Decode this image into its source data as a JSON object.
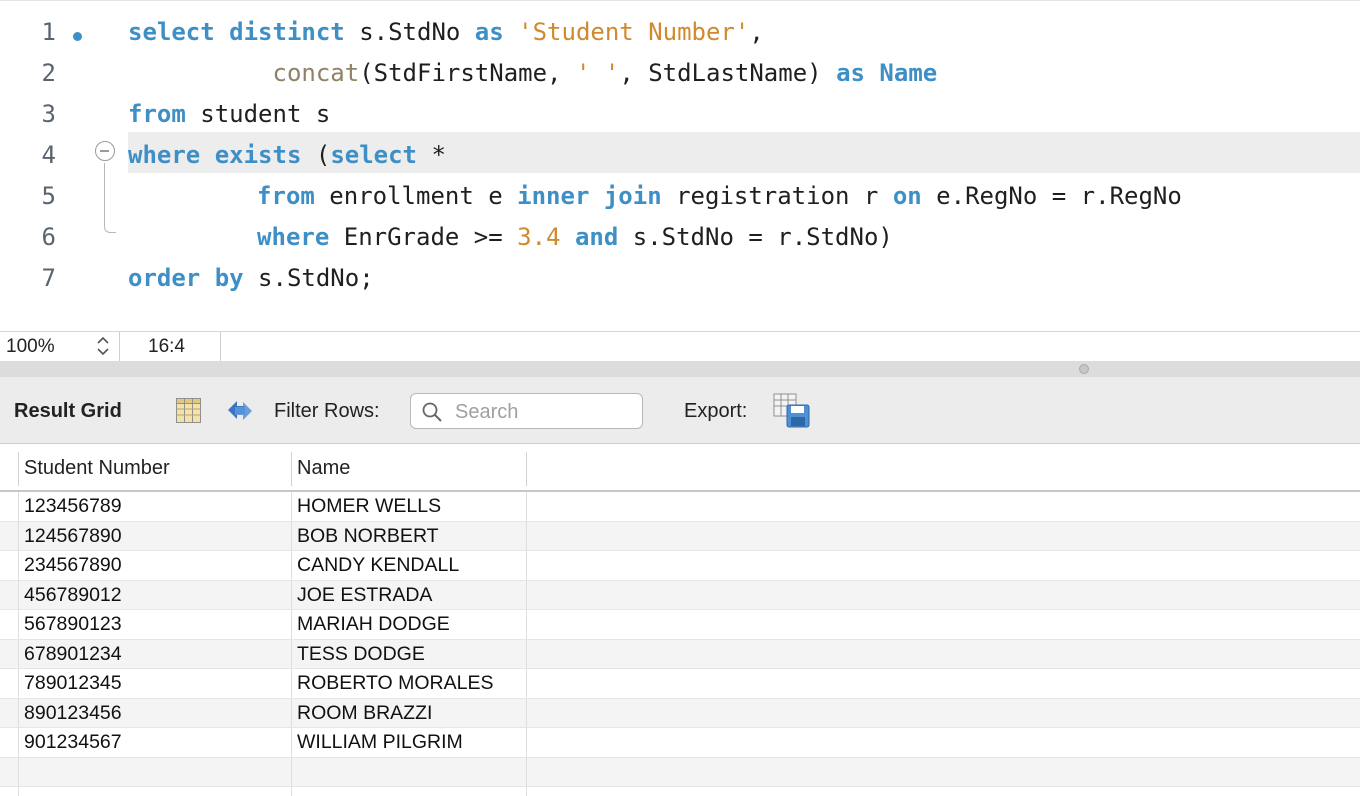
{
  "editor": {
    "lines": [
      {
        "num": "1",
        "tokens": [
          {
            "t": "select",
            "c": "kw"
          },
          {
            "t": " ",
            "c": "tx"
          },
          {
            "t": "distinct",
            "c": "kw"
          },
          {
            "t": " s.StdNo ",
            "c": "tx"
          },
          {
            "t": "as",
            "c": "kw"
          },
          {
            "t": " ",
            "c": "tx"
          },
          {
            "t": "'Student Number'",
            "c": "str"
          },
          {
            "t": ",",
            "c": "tx"
          }
        ]
      },
      {
        "num": "2",
        "tokens": [
          {
            "t": "          ",
            "c": "tx"
          },
          {
            "t": "concat",
            "c": "fn"
          },
          {
            "t": "(StdFirstName, ",
            "c": "tx"
          },
          {
            "t": "' '",
            "c": "str"
          },
          {
            "t": ", StdLastName) ",
            "c": "tx"
          },
          {
            "t": "as",
            "c": "kw"
          },
          {
            "t": " ",
            "c": "tx"
          },
          {
            "t": "Name",
            "c": "kw"
          }
        ]
      },
      {
        "num": "3",
        "tokens": [
          {
            "t": "from",
            "c": "kw"
          },
          {
            "t": " student s",
            "c": "tx"
          }
        ]
      },
      {
        "num": "4",
        "tokens": [
          {
            "t": "where",
            "c": "kw"
          },
          {
            "t": " ",
            "c": "tx"
          },
          {
            "t": "exists",
            "c": "kw"
          },
          {
            "t": " (",
            "c": "tx"
          },
          {
            "t": "select",
            "c": "kw"
          },
          {
            "t": " *",
            "c": "tx"
          }
        ]
      },
      {
        "num": "5",
        "tokens": [
          {
            "t": "         ",
            "c": "tx"
          },
          {
            "t": "from",
            "c": "kw"
          },
          {
            "t": " enrollment e ",
            "c": "tx"
          },
          {
            "t": "inner",
            "c": "kw"
          },
          {
            "t": " ",
            "c": "tx"
          },
          {
            "t": "join",
            "c": "kw"
          },
          {
            "t": " registration r ",
            "c": "tx"
          },
          {
            "t": "on",
            "c": "kw"
          },
          {
            "t": " e.RegNo = r.RegNo",
            "c": "tx"
          }
        ]
      },
      {
        "num": "6",
        "tokens": [
          {
            "t": "         ",
            "c": "tx"
          },
          {
            "t": "where",
            "c": "kw"
          },
          {
            "t": " EnrGrade >= ",
            "c": "tx"
          },
          {
            "t": "3.4",
            "c": "num"
          },
          {
            "t": " ",
            "c": "tx"
          },
          {
            "t": "and",
            "c": "kw"
          },
          {
            "t": " s.StdNo = r.StdNo)",
            "c": "tx"
          }
        ]
      },
      {
        "num": "7",
        "tokens": [
          {
            "t": "order",
            "c": "kw"
          },
          {
            "t": " ",
            "c": "tx"
          },
          {
            "t": "by",
            "c": "kw"
          },
          {
            "t": " s.StdNo;",
            "c": "tx"
          }
        ]
      }
    ]
  },
  "statusbar": {
    "zoom": "100%",
    "cursor_position": "16:4"
  },
  "toolbar": {
    "result_grid_label": "Result Grid",
    "filter_rows_label": "Filter Rows:",
    "search_placeholder": "Search",
    "export_label": "Export:"
  },
  "grid": {
    "columns": [
      "Student Number",
      "Name"
    ],
    "rows": [
      [
        "123456789",
        "HOMER WELLS"
      ],
      [
        "124567890",
        "BOB NORBERT"
      ],
      [
        "234567890",
        "CANDY KENDALL"
      ],
      [
        "456789012",
        "JOE ESTRADA"
      ],
      [
        "567890123",
        "MARIAH DODGE"
      ],
      [
        "678901234",
        "TESS DODGE"
      ],
      [
        "789012345",
        "ROBERTO MORALES"
      ],
      [
        "890123456",
        "ROOM BRAZZI"
      ],
      [
        "901234567",
        "WILLIAM PILGRIM"
      ]
    ]
  },
  "colors": {
    "keyword": "#3d8fc6",
    "string": "#d08a2e",
    "function": "#8f8266"
  }
}
